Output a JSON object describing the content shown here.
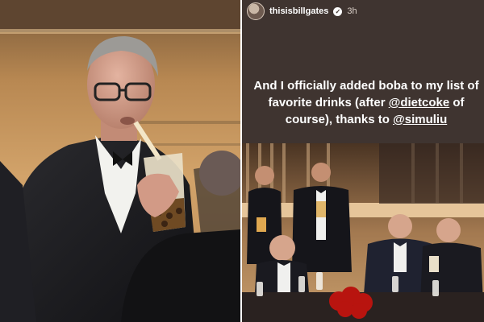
{
  "story": {
    "username": "thisisbillgates",
    "verified_icon": "check-badge-icon",
    "time": "3h",
    "caption": {
      "line1": "And I officially added boba to my list of",
      "line2": "favorite drinks (after ",
      "mention1": "@dietcoke",
      "line2b": " of",
      "line3": "course), thanks to ",
      "mention2": "@simuliu"
    }
  },
  "colors": {
    "story_bg": "#3f3430",
    "text": "#ffffff",
    "left_bg": "#c49a62"
  }
}
